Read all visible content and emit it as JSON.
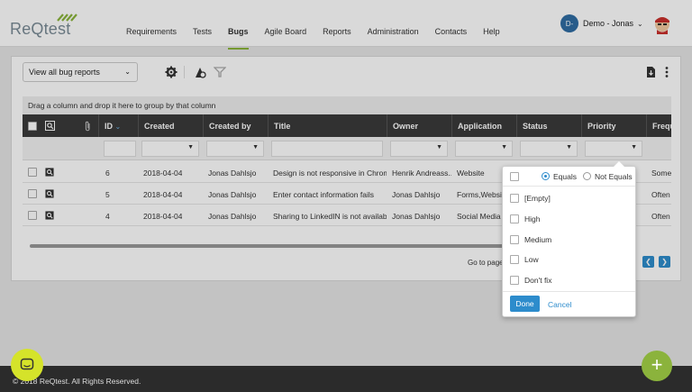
{
  "app": {
    "logo_text": "ReQtest",
    "footer": "© 2018 ReQtest. All Rights Reserved."
  },
  "nav": {
    "items": [
      {
        "label": "Requirements",
        "active": false
      },
      {
        "label": "Tests",
        "active": false
      },
      {
        "label": "Bugs",
        "active": true
      },
      {
        "label": "Agile Board",
        "active": false
      },
      {
        "label": "Reports",
        "active": false
      },
      {
        "label": "Administration",
        "active": false
      },
      {
        "label": "Contacts",
        "active": false
      },
      {
        "label": "Help",
        "active": false
      }
    ]
  },
  "user": {
    "initials": "D-",
    "name": "Demo - Jonas"
  },
  "toolbar": {
    "view_select": "View all bug reports"
  },
  "grid": {
    "group_hint": "Drag a column and drop it here to group by that column",
    "columns": [
      "ID",
      "Created",
      "Created by",
      "Title",
      "Owner",
      "Application",
      "Status",
      "Priority",
      "Frequ"
    ],
    "rows": [
      {
        "id": "6",
        "created": "2018-04-04",
        "created_by": "Jonas Dahlsjo",
        "title": "Design is not responsive in Chrome",
        "owner": "Henrik Andreass...",
        "application": "Website",
        "frequency": "Sometim"
      },
      {
        "id": "5",
        "created": "2018-04-04",
        "created_by": "Jonas Dahlsjo",
        "title": "Enter contact information fails",
        "owner": "Jonas Dahlsjo",
        "application": "Forms,Website",
        "frequency": "Often for m"
      },
      {
        "id": "4",
        "created": "2018-04-04",
        "created_by": "Jonas Dahlsjo",
        "title": "Sharing to LinkedIN is not available",
        "owner": "Jonas Dahlsjo",
        "application": "Social Media",
        "frequency": "Often for a"
      }
    ],
    "goto_label": "Go to page:"
  },
  "filter_popup": {
    "equals_label": "Equals",
    "not_equals_label": "Not Equals",
    "selected_mode": "Equals",
    "options": [
      "[Empty]",
      "High",
      "Medium",
      "Low",
      "Don't fix"
    ],
    "done_label": "Done",
    "cancel_label": "Cancel"
  },
  "colors": {
    "accent_green": "#8ab43a",
    "action_blue": "#2d8ccc",
    "header_dark": "#3a3a3a"
  }
}
